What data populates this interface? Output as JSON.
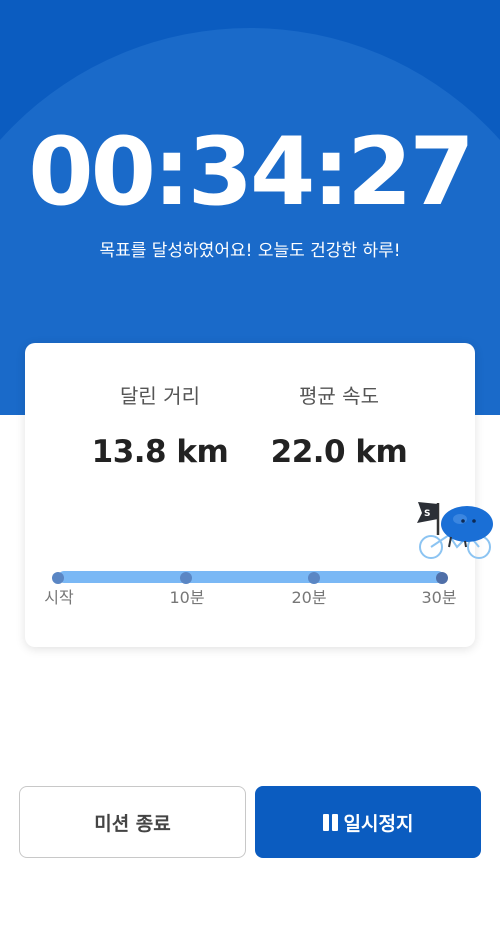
{
  "hero": {
    "timer": "00:34:27",
    "message": "목표를 달성하였어요! 오늘도 건강한 하루!"
  },
  "stats": {
    "distance_label": "달린 거리",
    "distance_value": "13.8 km",
    "speed_label": "평균 속도",
    "speed_value": "22.0 km"
  },
  "progress": {
    "ticks": [
      "시작",
      "10분",
      "20분",
      "30분"
    ],
    "fraction": 1.0,
    "flag_letter": "S"
  },
  "buttons": {
    "end_mission": "미션 종료",
    "pause": "일시정지"
  },
  "colors": {
    "brand": "#0b5cc0",
    "track": "#7ab8f5",
    "mascot": "#1a6fd6"
  },
  "icons": {
    "mascot": "bike-mascot-icon",
    "flag": "flag-icon",
    "pause": "pause-icon"
  }
}
